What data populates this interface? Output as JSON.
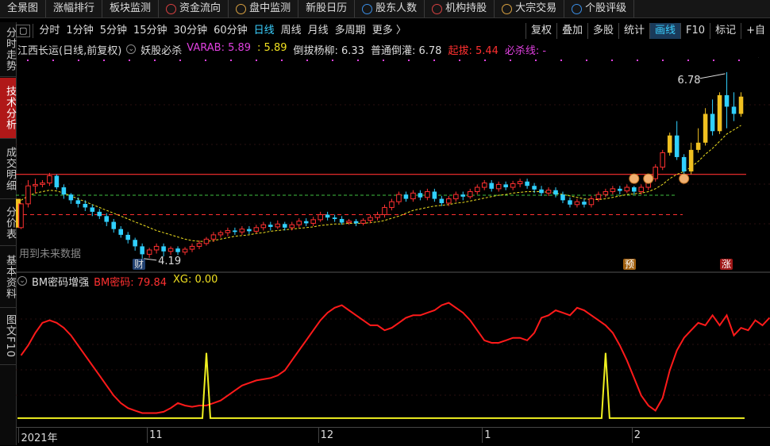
{
  "top_nav": [
    {
      "label": "全景图",
      "icon": ""
    },
    {
      "label": "涨幅排行",
      "icon": ""
    },
    {
      "label": "板块监测",
      "icon": ""
    },
    {
      "label": "资金流向",
      "icon": "money-flow-icon"
    },
    {
      "label": "盘中监测",
      "icon": "monitor-icon"
    },
    {
      "label": "新股日历",
      "icon": ""
    },
    {
      "label": "股东人数",
      "icon": "shareholder-icon"
    },
    {
      "label": "机构持股",
      "icon": "institution-icon"
    },
    {
      "label": "大宗交易",
      "icon": "bulk-trade-icon"
    },
    {
      "label": "个股评级",
      "icon": "rating-icon"
    }
  ],
  "toolbar": {
    "periods": [
      "分时",
      "1分钟",
      "5分钟",
      "15分钟",
      "30分钟",
      "60分钟",
      "日线",
      "周线",
      "月线",
      "多周期",
      "更多 〉"
    ],
    "active_period": "日线",
    "right_buttons": [
      "复权",
      "叠加",
      "多股",
      "统计",
      "画线",
      "F10",
      "标记",
      "+自"
    ],
    "active_right": "画线"
  },
  "side_tabs": [
    "分时走势",
    "技术分析",
    "成交明细",
    "分价表",
    "基本资料",
    "图文F10"
  ],
  "active_side_tab": "技术分析",
  "main_legend": {
    "stock": "江西长运(日线,前复权)",
    "indicator": "妖股必杀",
    "items": [
      {
        "label": "VARAB: 5.89",
        "color": "#e040e0"
      },
      {
        "label": ": 5.89",
        "color": "#f0e020"
      },
      {
        "label": "倒拔杨柳: 6.33",
        "color": "#dddddd"
      },
      {
        "label": "普通倒灌: 6.78",
        "color": "#dddddd"
      },
      {
        "label": "起拔: 5.44",
        "color": "#ff3030"
      },
      {
        "label": "必杀线: -",
        "color": "#e040e0"
      }
    ]
  },
  "annotations": {
    "high_price": "6.78",
    "low_price": "4.19",
    "future_data": "用到未来数据",
    "cai_marker": "财",
    "yu_marker": "预",
    "zhang_marker": "涨"
  },
  "indicator_legend": {
    "name": "BM密码增强",
    "items": [
      {
        "label": "BM密码: 79.84",
        "color": "#ff3030"
      },
      {
        "label": "XG: 0.00",
        "color": "#f0e020"
      }
    ]
  },
  "time_axis": [
    "2021年",
    "11",
    "12",
    "1",
    "2"
  ],
  "colors": {
    "up": "#ff3030",
    "down": "#30d0ff",
    "limit_up": "#f0c020",
    "ma": "#f0e020",
    "guide_red": "#ff3030",
    "guide_green": "#40c040",
    "bm": "#ff1a1a",
    "xg": "#f0f020"
  },
  "chart_data": {
    "type": "candlestick",
    "price_range": [
      4.1,
      6.9
    ],
    "candles": [
      [
        4.62,
        4.95,
        4.6,
        4.96
      ],
      [
        4.95,
        5.2,
        4.9,
        5.28
      ],
      [
        5.2,
        5.22,
        5.1,
        5.3
      ],
      [
        5.22,
        5.24,
        5.18,
        5.28
      ],
      [
        5.24,
        5.34,
        5.2,
        5.38
      ],
      [
        5.34,
        5.18,
        5.15,
        5.36
      ],
      [
        5.18,
        5.08,
        5.02,
        5.22
      ],
      [
        5.08,
        5.0,
        4.95,
        5.1
      ],
      [
        5.0,
        4.95,
        4.9,
        5.04
      ],
      [
        4.95,
        4.9,
        4.85,
        5.0
      ],
      [
        4.9,
        4.84,
        4.78,
        4.94
      ],
      [
        4.84,
        4.78,
        4.74,
        4.88
      ],
      [
        4.78,
        4.7,
        4.64,
        4.82
      ],
      [
        4.7,
        4.6,
        4.55,
        4.74
      ],
      [
        4.6,
        4.52,
        4.48,
        4.64
      ],
      [
        4.52,
        4.45,
        4.4,
        4.56
      ],
      [
        4.45,
        4.36,
        4.3,
        4.48
      ],
      [
        4.36,
        4.25,
        4.19,
        4.4
      ],
      [
        4.25,
        4.31,
        4.2,
        4.34
      ],
      [
        4.31,
        4.36,
        4.26,
        4.4
      ],
      [
        4.36,
        4.29,
        4.22,
        4.4
      ],
      [
        4.29,
        4.33,
        4.24,
        4.36
      ],
      [
        4.33,
        4.28,
        4.24,
        4.36
      ],
      [
        4.28,
        4.32,
        4.24,
        4.35
      ],
      [
        4.32,
        4.36,
        4.28,
        4.4
      ],
      [
        4.36,
        4.4,
        4.32,
        4.44
      ],
      [
        4.4,
        4.46,
        4.37,
        4.49
      ],
      [
        4.46,
        4.52,
        4.42,
        4.56
      ],
      [
        4.52,
        4.55,
        4.48,
        4.58
      ],
      [
        4.55,
        4.58,
        4.5,
        4.62
      ],
      [
        4.58,
        4.56,
        4.52,
        4.62
      ],
      [
        4.56,
        4.6,
        4.52,
        4.64
      ],
      [
        4.6,
        4.57,
        4.53,
        4.64
      ],
      [
        4.57,
        4.62,
        4.54,
        4.66
      ],
      [
        4.62,
        4.66,
        4.58,
        4.7
      ],
      [
        4.66,
        4.63,
        4.58,
        4.7
      ],
      [
        4.63,
        4.67,
        4.6,
        4.72
      ],
      [
        4.67,
        4.62,
        4.58,
        4.7
      ],
      [
        4.62,
        4.66,
        4.58,
        4.7
      ],
      [
        4.66,
        4.71,
        4.62,
        4.75
      ],
      [
        4.71,
        4.68,
        4.64,
        4.75
      ],
      [
        4.68,
        4.73,
        4.64,
        4.77
      ],
      [
        4.73,
        4.8,
        4.7,
        4.84
      ],
      [
        4.8,
        4.76,
        4.72,
        4.84
      ],
      [
        4.76,
        4.74,
        4.7,
        4.8
      ],
      [
        4.74,
        4.69,
        4.66,
        4.78
      ],
      [
        4.69,
        4.71,
        4.66,
        4.74
      ],
      [
        4.71,
        4.68,
        4.64,
        4.74
      ],
      [
        4.68,
        4.72,
        4.65,
        4.75
      ],
      [
        4.72,
        4.76,
        4.68,
        4.8
      ],
      [
        4.76,
        4.8,
        4.72,
        4.84
      ],
      [
        4.8,
        4.9,
        4.76,
        4.94
      ],
      [
        4.9,
        4.98,
        4.86,
        5.02
      ],
      [
        4.98,
        5.08,
        4.94,
        5.12
      ],
      [
        5.08,
        5.02,
        4.98,
        5.12
      ],
      [
        5.02,
        5.1,
        4.98,
        5.14
      ],
      [
        5.1,
        5.04,
        5.0,
        5.14
      ],
      [
        5.04,
        5.12,
        5.0,
        5.16
      ],
      [
        5.12,
        5.02,
        4.98,
        5.16
      ],
      [
        5.02,
        4.96,
        4.92,
        5.06
      ],
      [
        4.96,
        5.02,
        4.92,
        5.06
      ],
      [
        5.02,
        5.08,
        4.98,
        5.12
      ],
      [
        5.08,
        5.05,
        5.0,
        5.12
      ],
      [
        5.05,
        5.12,
        5.02,
        5.16
      ],
      [
        5.12,
        5.18,
        5.08,
        5.22
      ],
      [
        5.18,
        5.24,
        5.14,
        5.28
      ],
      [
        5.24,
        5.16,
        5.12,
        5.28
      ],
      [
        5.16,
        5.22,
        5.12,
        5.26
      ],
      [
        5.22,
        5.18,
        5.14,
        5.26
      ],
      [
        5.18,
        5.23,
        5.14,
        5.27
      ],
      [
        5.23,
        5.26,
        5.18,
        5.3
      ],
      [
        5.26,
        5.2,
        5.16,
        5.3
      ],
      [
        5.2,
        5.15,
        5.1,
        5.24
      ],
      [
        5.15,
        5.1,
        5.06,
        5.2
      ],
      [
        5.1,
        5.14,
        5.06,
        5.18
      ],
      [
        5.14,
        5.08,
        5.04,
        5.18
      ],
      [
        5.08,
        5.0,
        4.96,
        5.12
      ],
      [
        5.0,
        4.94,
        4.9,
        5.04
      ],
      [
        4.94,
        4.98,
        4.9,
        5.02
      ],
      [
        4.98,
        4.94,
        4.9,
        5.02
      ],
      [
        4.94,
        5.02,
        4.9,
        5.06
      ],
      [
        5.02,
        5.08,
        4.98,
        5.12
      ],
      [
        5.08,
        5.12,
        5.04,
        5.16
      ],
      [
        5.12,
        5.16,
        5.08,
        5.2
      ],
      [
        5.16,
        5.13,
        5.08,
        5.2
      ],
      [
        5.13,
        5.18,
        5.1,
        5.22
      ],
      [
        5.18,
        5.12,
        5.08,
        5.2
      ],
      [
        5.12,
        5.18,
        5.08,
        5.22
      ],
      [
        5.18,
        5.3,
        5.14,
        5.34
      ],
      [
        5.3,
        5.46,
        5.26,
        5.5
      ],
      [
        5.46,
        5.66,
        5.42,
        5.7
      ],
      [
        5.66,
        5.9,
        5.62,
        5.94
      ],
      [
        5.9,
        5.6,
        5.56,
        6.1
      ],
      [
        5.6,
        5.4,
        5.36,
        5.64
      ],
      [
        5.4,
        5.7,
        5.36,
        5.8
      ],
      [
        5.7,
        5.8,
        5.66,
        6.0
      ],
      [
        5.8,
        6.2,
        5.76,
        6.28
      ],
      [
        6.2,
        5.96,
        5.9,
        6.4
      ],
      [
        5.96,
        6.46,
        5.92,
        6.5
      ],
      [
        6.46,
        6.3,
        6.0,
        6.78
      ],
      [
        6.3,
        6.2,
        6.1,
        6.5
      ],
      [
        6.2,
        6.44,
        6.16,
        6.5
      ]
    ],
    "limit_up_indices": [
      91,
      92,
      94,
      95,
      96,
      98,
      99,
      101
    ],
    "ma": [
      5.0,
      5.06,
      5.1,
      5.12,
      5.14,
      5.13,
      5.1,
      5.06,
      5.02,
      4.98,
      4.94,
      4.9,
      4.86,
      4.82,
      4.78,
      4.74,
      4.7,
      4.66,
      4.62,
      4.58,
      4.55,
      4.52,
      4.49,
      4.46,
      4.44,
      4.43,
      4.43,
      4.44,
      4.46,
      4.48,
      4.5,
      4.51,
      4.52,
      4.54,
      4.55,
      4.57,
      4.58,
      4.59,
      4.6,
      4.61,
      4.62,
      4.63,
      4.65,
      4.66,
      4.67,
      4.67,
      4.68,
      4.68,
      4.68,
      4.69,
      4.7,
      4.72,
      4.75,
      4.78,
      4.82,
      4.86,
      4.88,
      4.9,
      4.92,
      4.93,
      4.94,
      4.96,
      4.97,
      4.99,
      5.01,
      5.03,
      5.05,
      5.07,
      5.08,
      5.1,
      5.11,
      5.12,
      5.12,
      5.12,
      5.11,
      5.1,
      5.08,
      5.06,
      5.04,
      5.02,
      5.01,
      5.01,
      5.02,
      5.04,
      5.06,
      5.08,
      5.09,
      5.1,
      5.12,
      5.16,
      5.22,
      5.3,
      5.36,
      5.4,
      5.46,
      5.54,
      5.64,
      5.72,
      5.82,
      5.92,
      5.98,
      6.04
    ],
    "guide_red_upper": 5.36,
    "guide_red_lower": 4.8,
    "guide_green": 5.07,
    "bm_value_range": [
      0,
      100
    ],
    "bm": [
      52,
      60,
      70,
      78,
      80,
      78,
      74,
      68,
      60,
      52,
      44,
      36,
      28,
      20,
      14,
      10,
      8,
      6,
      6,
      6,
      7,
      10,
      14,
      12,
      11,
      12,
      12,
      14,
      16,
      20,
      24,
      28,
      30,
      32,
      33,
      34,
      36,
      40,
      48,
      56,
      64,
      72,
      80,
      86,
      90,
      92,
      88,
      84,
      80,
      76,
      76,
      72,
      74,
      78,
      82,
      84,
      84,
      86,
      88,
      92,
      94,
      90,
      86,
      80,
      72,
      64,
      62,
      62,
      64,
      66,
      66,
      64,
      70,
      82,
      84,
      88,
      86,
      84,
      90,
      88,
      84,
      80,
      76,
      70,
      60,
      48,
      34,
      20,
      12,
      8,
      18,
      40,
      56,
      66,
      72,
      78,
      76,
      84,
      76,
      84,
      68,
      74,
      72,
      80,
      76,
      82
    ],
    "xg_spikes": [
      26,
      82
    ],
    "xg_base": 2,
    "xg_high": 54
  }
}
